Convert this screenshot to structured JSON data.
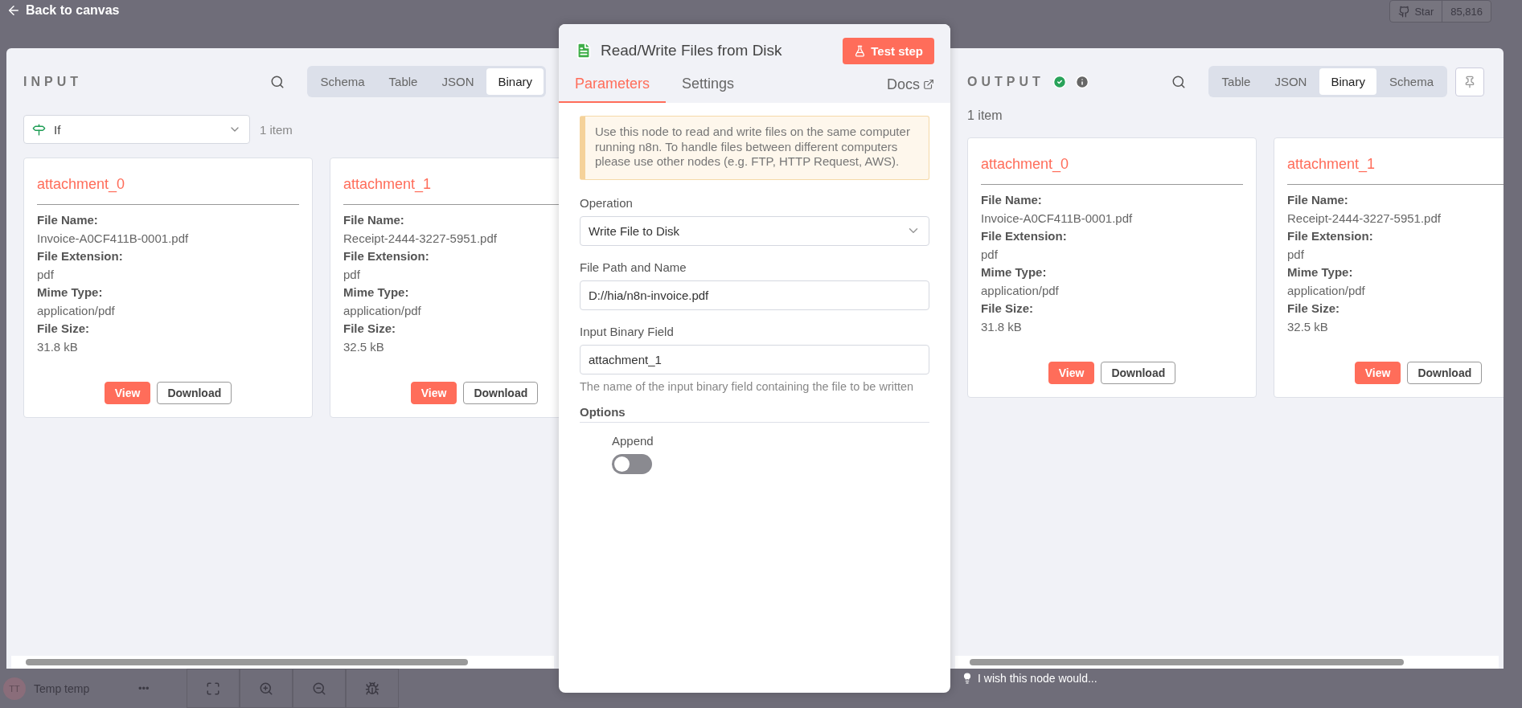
{
  "topbar": {
    "back": "Back to canvas",
    "star": "Star",
    "star_count": "85,816"
  },
  "input": {
    "title": "INPUT",
    "tabs": [
      {
        "label": "Schema",
        "selected": false
      },
      {
        "label": "Table",
        "selected": false
      },
      {
        "label": "JSON",
        "selected": false
      },
      {
        "label": "Binary",
        "selected": true
      }
    ],
    "node_select": {
      "value": "If"
    },
    "item_count": "1 item",
    "cards": [
      {
        "name": "attachment_0",
        "fields": [
          {
            "label": "File Name:",
            "value": "Invoice-A0CF411B-0001.pdf"
          },
          {
            "label": "File Extension:",
            "value": "pdf"
          },
          {
            "label": "Mime Type:",
            "value": "application/pdf"
          },
          {
            "label": "File Size:",
            "value": "31.8 kB"
          }
        ],
        "buttons": [
          {
            "label": "View",
            "kind": "primary"
          },
          {
            "label": "Download",
            "kind": "outline"
          }
        ]
      },
      {
        "name": "attachment_1",
        "fields": [
          {
            "label": "File Name:",
            "value": "Receipt-2444-3227-5951.pdf"
          },
          {
            "label": "File Extension:",
            "value": "pdf"
          },
          {
            "label": "Mime Type:",
            "value": "application/pdf"
          },
          {
            "label": "File Size:",
            "value": "32.5 kB"
          }
        ],
        "buttons": [
          {
            "label": "View",
            "kind": "primary"
          },
          {
            "label": "Download",
            "kind": "outline"
          }
        ]
      }
    ]
  },
  "node": {
    "title": "Read/Write Files from Disk",
    "test_button": "Test step",
    "tabs": [
      {
        "label": "Parameters",
        "selected": true
      },
      {
        "label": "Settings",
        "selected": false
      }
    ],
    "docs": "Docs",
    "notice": "Use this node to read and write files on the same computer running n8n. To handle files between different computers please use other nodes (e.g. FTP, HTTP Request, AWS).",
    "params": [
      {
        "kind": "select",
        "label": "Operation",
        "value": "Write File to Disk"
      },
      {
        "kind": "input",
        "label": "File Path and Name",
        "value": "D://hia/n8n-invoice.pdf"
      },
      {
        "kind": "input",
        "label": "Input Binary Field",
        "value": "attachment_1",
        "hint": "The name of the input binary field containing the file to be written"
      }
    ],
    "options_title": "Options",
    "options": [
      {
        "kind": "toggle",
        "label": "Append",
        "on": false
      }
    ]
  },
  "output": {
    "title": "OUTPUT",
    "success": true,
    "tabs": [
      {
        "label": "Table",
        "selected": false
      },
      {
        "label": "JSON",
        "selected": false
      },
      {
        "label": "Binary",
        "selected": true
      },
      {
        "label": "Schema",
        "selected": false
      }
    ],
    "item_count": "1 item",
    "cards": [
      {
        "name": "attachment_0",
        "fields": [
          {
            "label": "File Name:",
            "value": "Invoice-A0CF411B-0001.pdf"
          },
          {
            "label": "File Extension:",
            "value": "pdf"
          },
          {
            "label": "Mime Type:",
            "value": "application/pdf"
          },
          {
            "label": "File Size:",
            "value": "31.8 kB"
          }
        ],
        "buttons": [
          {
            "label": "View",
            "kind": "primary"
          },
          {
            "label": "Download",
            "kind": "outline"
          }
        ]
      },
      {
        "name": "attachment_1",
        "fields": [
          {
            "label": "File Name:",
            "value": "Receipt-2444-3227-5951.pdf"
          },
          {
            "label": "File Extension:",
            "value": "pdf"
          },
          {
            "label": "Mime Type:",
            "value": "application/pdf"
          },
          {
            "label": "File Size:",
            "value": "32.5 kB"
          }
        ],
        "buttons": [
          {
            "label": "View",
            "kind": "primary"
          },
          {
            "label": "Download",
            "kind": "outline"
          }
        ]
      }
    ]
  },
  "bottom": {
    "avatar": "TT",
    "user": "Temp temp",
    "more": "•••",
    "feedback": "I wish this node would..."
  }
}
